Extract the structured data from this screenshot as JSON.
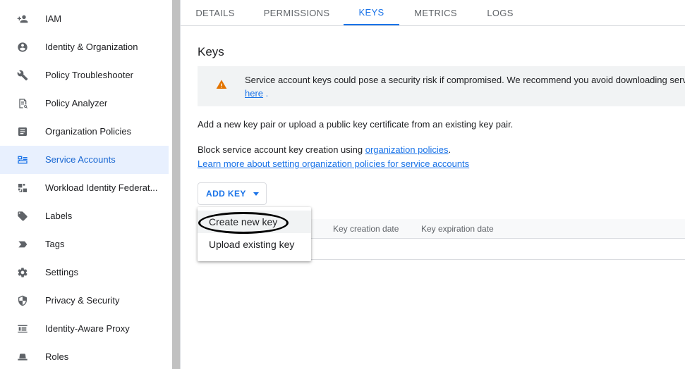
{
  "sidebar": {
    "items": [
      {
        "label": "IAM",
        "icon": "person-add-icon"
      },
      {
        "label": "Identity & Organization",
        "icon": "account-circle-icon"
      },
      {
        "label": "Policy Troubleshooter",
        "icon": "wrench-icon"
      },
      {
        "label": "Policy Analyzer",
        "icon": "policy-analyzer-icon"
      },
      {
        "label": "Organization Policies",
        "icon": "article-icon"
      },
      {
        "label": "Service Accounts",
        "icon": "service-account-icon",
        "active": true
      },
      {
        "label": "Workload Identity Federat...",
        "icon": "workload-identity-icon"
      },
      {
        "label": "Labels",
        "icon": "label-icon"
      },
      {
        "label": "Tags",
        "icon": "tag-icon"
      },
      {
        "label": "Settings",
        "icon": "gear-icon"
      },
      {
        "label": "Privacy & Security",
        "icon": "shield-icon"
      },
      {
        "label": "Identity-Aware Proxy",
        "icon": "proxy-icon"
      },
      {
        "label": "Roles",
        "icon": "hat-icon"
      }
    ]
  },
  "tabs": [
    {
      "label": "DETAILS"
    },
    {
      "label": "PERMISSIONS"
    },
    {
      "label": "KEYS",
      "active": true
    },
    {
      "label": "METRICS"
    },
    {
      "label": "LOGS"
    }
  ],
  "keys": {
    "heading": "Keys",
    "warning_text": "Service account keys could pose a security risk if compromised. We recommend you avoid downloading serv",
    "warning_link": "here",
    "warning_link_suffix": ".",
    "add_pair_text": "Add a new key pair or upload a public key certificate from an existing key pair.",
    "block_text": "Block service account key creation using ",
    "block_link": "organization policies",
    "block_suffix": ".",
    "learn_more_link": "Learn more about setting organization policies for service accounts",
    "add_key_label": "ADD KEY",
    "table_headers": [
      "Key creation date",
      "Key expiration date"
    ]
  },
  "add_key_menu": {
    "items": [
      "Create new key",
      "Upload existing key"
    ]
  },
  "colors": {
    "accent": "#1a73e8",
    "warning": "#e37400"
  }
}
